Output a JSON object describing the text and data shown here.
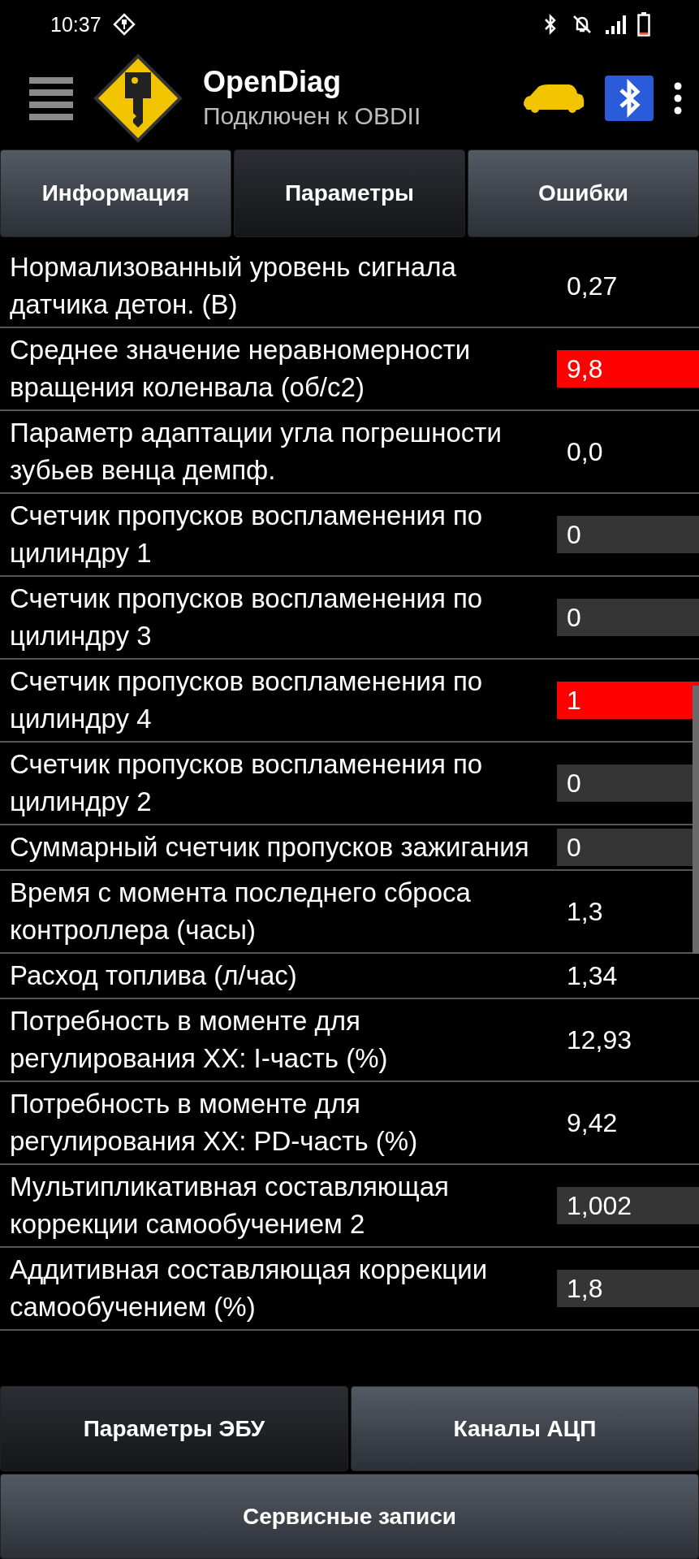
{
  "status_bar": {
    "time": "10:37"
  },
  "app_bar": {
    "title": "OpenDiag",
    "subtitle": "Подключен к OBDII"
  },
  "tabs": [
    {
      "label": "Информация",
      "selected": false
    },
    {
      "label": "Параметры",
      "selected": true
    },
    {
      "label": "Ошибки",
      "selected": false
    }
  ],
  "parameters": [
    {
      "label": "Нормализованный уровень сигнала датчика детон. (В)",
      "value": "0,27",
      "kind": "plain"
    },
    {
      "label": "Среднее значение неравномерности вращения коленвала (об/с2)",
      "value": "9,8",
      "kind": "alert"
    },
    {
      "label": "Параметр адаптации угла погрешности зубьев венца демпф.",
      "value": "0,0",
      "kind": "plain"
    },
    {
      "label": "Счетчик пропусков воспламенения по цилиндру 1",
      "value": "0",
      "kind": "boxed"
    },
    {
      "label": "Счетчик пропусков воспламенения по цилиндру 3",
      "value": "0",
      "kind": "boxed"
    },
    {
      "label": "Счетчик пропусков воспламенения по цилиндру 4",
      "value": "1",
      "kind": "alert"
    },
    {
      "label": "Счетчик пропусков воспламенения по цилиндру 2",
      "value": "0",
      "kind": "boxed"
    },
    {
      "label": "Суммарный счетчик пропусков зажигания",
      "value": "0",
      "kind": "boxed"
    },
    {
      "label": "Время с момента последнего сброса контроллера (часы)",
      "value": "1,3",
      "kind": "plain"
    },
    {
      "label": "Расход топлива (л/час)",
      "value": "1,34",
      "kind": "plain"
    },
    {
      "label": "Потребность в моменте для регулирования ХХ: I-часть (%)",
      "value": "12,93",
      "kind": "plain"
    },
    {
      "label": "Потребность в моменте для регулирования ХХ: PD-часть (%)",
      "value": "9,42",
      "kind": "plain"
    },
    {
      "label": "Мультипликативная составляющая коррекции самообучением 2",
      "value": "1,002",
      "kind": "boxed"
    },
    {
      "label": "Аддитивная составляющая коррекции самообучением (%)",
      "value": "1,8",
      "kind": "boxed"
    }
  ],
  "bottom_buttons": [
    {
      "label": "Параметры ЭБУ",
      "selected": true
    },
    {
      "label": "Каналы АЦП",
      "selected": false
    },
    {
      "label": "Сервисные записи",
      "selected": false
    }
  ]
}
